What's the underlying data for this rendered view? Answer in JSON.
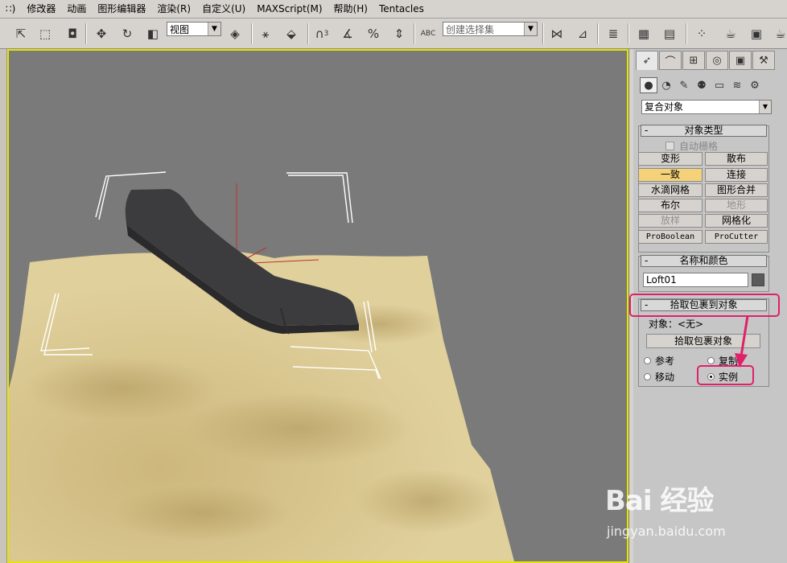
{
  "menu": {
    "items": [
      "∷)",
      "修改器",
      "动画",
      "图形编辑器",
      "渲染(R)",
      "自定义(U)",
      "MAXScript(M)",
      "帮助(H)",
      "Tentacles"
    ]
  },
  "toolbar": {
    "view_select": "视图",
    "selection_set_placeholder": "创建选择集",
    "snap_label": "3",
    "abc_label": "ABC"
  },
  "panel": {
    "category_dropdown": "复合对象",
    "object_type": {
      "title": "对象类型",
      "auto_grid": "自动栅格",
      "buttons": [
        {
          "label": "变形",
          "state": "normal"
        },
        {
          "label": "散布",
          "state": "normal"
        },
        {
          "label": "一致",
          "state": "active"
        },
        {
          "label": "连接",
          "state": "normal"
        },
        {
          "label": "水滴网格",
          "state": "normal"
        },
        {
          "label": "图形合并",
          "state": "normal"
        },
        {
          "label": "布尔",
          "state": "normal"
        },
        {
          "label": "地形",
          "state": "disabled"
        },
        {
          "label": "放样",
          "state": "disabled"
        },
        {
          "label": "网格化",
          "state": "normal"
        },
        {
          "label": "ProBoolean",
          "state": "normal"
        },
        {
          "label": "ProCutter",
          "state": "normal"
        }
      ]
    },
    "name_color": {
      "title": "名称和颜色",
      "name_value": "Loft01",
      "color": "#5a5a5a"
    },
    "pick_wrap": {
      "title": "拾取包裹到对象",
      "object_label": "对象：<无>",
      "pick_button": "拾取包裹对象",
      "radio_ref": "参考",
      "radio_copy": "复制",
      "radio_move": "移动",
      "radio_instance": "实例",
      "selected": "实例"
    },
    "minus": "-"
  },
  "watermark": {
    "logo": "Bai 经验",
    "url": "jingyan.baidu.com"
  },
  "colors": {
    "highlight": "#e0206a",
    "viewport_bg": "#7a7a7a",
    "terrain": "#d8c48c",
    "object": "#3a3a3c",
    "active_button": "#f5d27a"
  }
}
